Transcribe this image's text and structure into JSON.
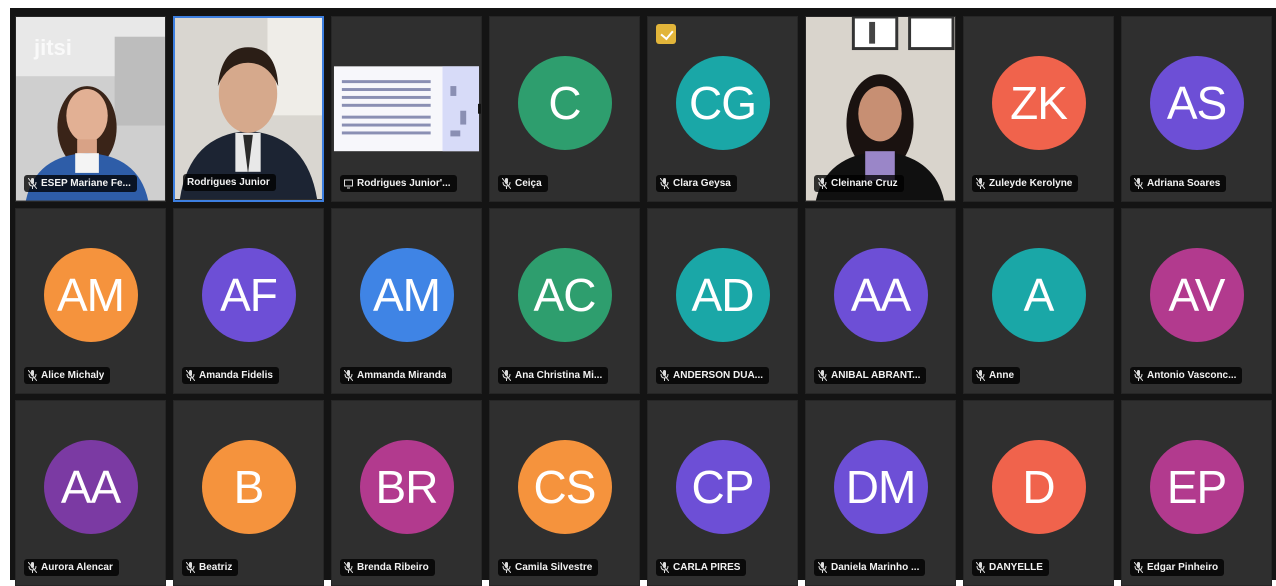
{
  "watermark": "jitsi",
  "participants": [
    {
      "name": "ESEP Mariane Fe...",
      "type": "video"
    },
    {
      "name": "Rodrigues Junior",
      "type": "video",
      "active": true
    },
    {
      "name": "Rodrigues Junior'...",
      "type": "screen"
    },
    {
      "name": "Ceiça",
      "initials": "C",
      "color": "#2e9e6e"
    },
    {
      "name": "Clara Geysa",
      "initials": "CG",
      "color": "#1aa7a7"
    },
    {
      "name": "Cleinane Cruz",
      "type": "video"
    },
    {
      "name": "Zuleyde Kerolyne",
      "initials": "ZK",
      "color": "#f0634c"
    },
    {
      "name": "Adriana Soares",
      "initials": "AS",
      "color": "#6d4fd6"
    },
    {
      "name": "Alice Michaly",
      "initials": "AM",
      "color": "#f5933d"
    },
    {
      "name": "Amanda Fidelis",
      "initials": "AF",
      "color": "#6d4fd6"
    },
    {
      "name": "Ammanda Miranda",
      "initials": "AM",
      "color": "#3f84e5"
    },
    {
      "name": "Ana Christina Mi...",
      "initials": "AC",
      "color": "#2e9e6e"
    },
    {
      "name": "ANDERSON DUA...",
      "initials": "AD",
      "color": "#1aa7a7"
    },
    {
      "name": "ANIBAL ABRANT...",
      "initials": "AA",
      "color": "#6d4fd6"
    },
    {
      "name": "Anne",
      "initials": "A",
      "color": "#1aa7a7"
    },
    {
      "name": "Antonio Vasconc...",
      "initials": "AV",
      "color": "#b23a8e"
    },
    {
      "name": "Aurora Alencar",
      "initials": "AA",
      "color": "#7b3aa3"
    },
    {
      "name": "Beatriz",
      "initials": "B",
      "color": "#f5933d"
    },
    {
      "name": "Brenda Ribeiro",
      "initials": "BR",
      "color": "#b23a8e"
    },
    {
      "name": "Camila Silvestre",
      "initials": "CS",
      "color": "#f5933d"
    },
    {
      "name": "CARLA PIRES",
      "initials": "CP",
      "color": "#6d4fd6"
    },
    {
      "name": "Daniela Marinho ...",
      "initials": "DM",
      "color": "#6d4fd6"
    },
    {
      "name": "DANYELLE",
      "initials": "D",
      "color": "#f0634c"
    },
    {
      "name": "Edgar Pinheiro",
      "initials": "EP",
      "color": "#b23a8e"
    }
  ]
}
